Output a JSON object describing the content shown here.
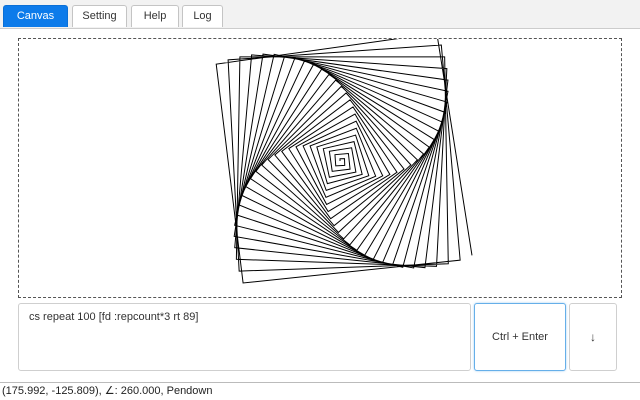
{
  "tabs": {
    "canvas": "Canvas",
    "setting": "Setting",
    "help": "Help",
    "log": "Log"
  },
  "editor": {
    "code": "cs repeat 100 [fd :repcount*3 rt 89]"
  },
  "buttons": {
    "run": "Ctrl + Enter",
    "down": "↓"
  },
  "status": {
    "coords": "(175.992, -125.809),",
    "heading": "∠: 260.000,",
    "pen": "Pendown"
  },
  "colors": {
    "active_tab": "#0d7bea",
    "drawing_stroke": "#000000"
  },
  "icons": {
    "down": "down-arrow-icon"
  }
}
